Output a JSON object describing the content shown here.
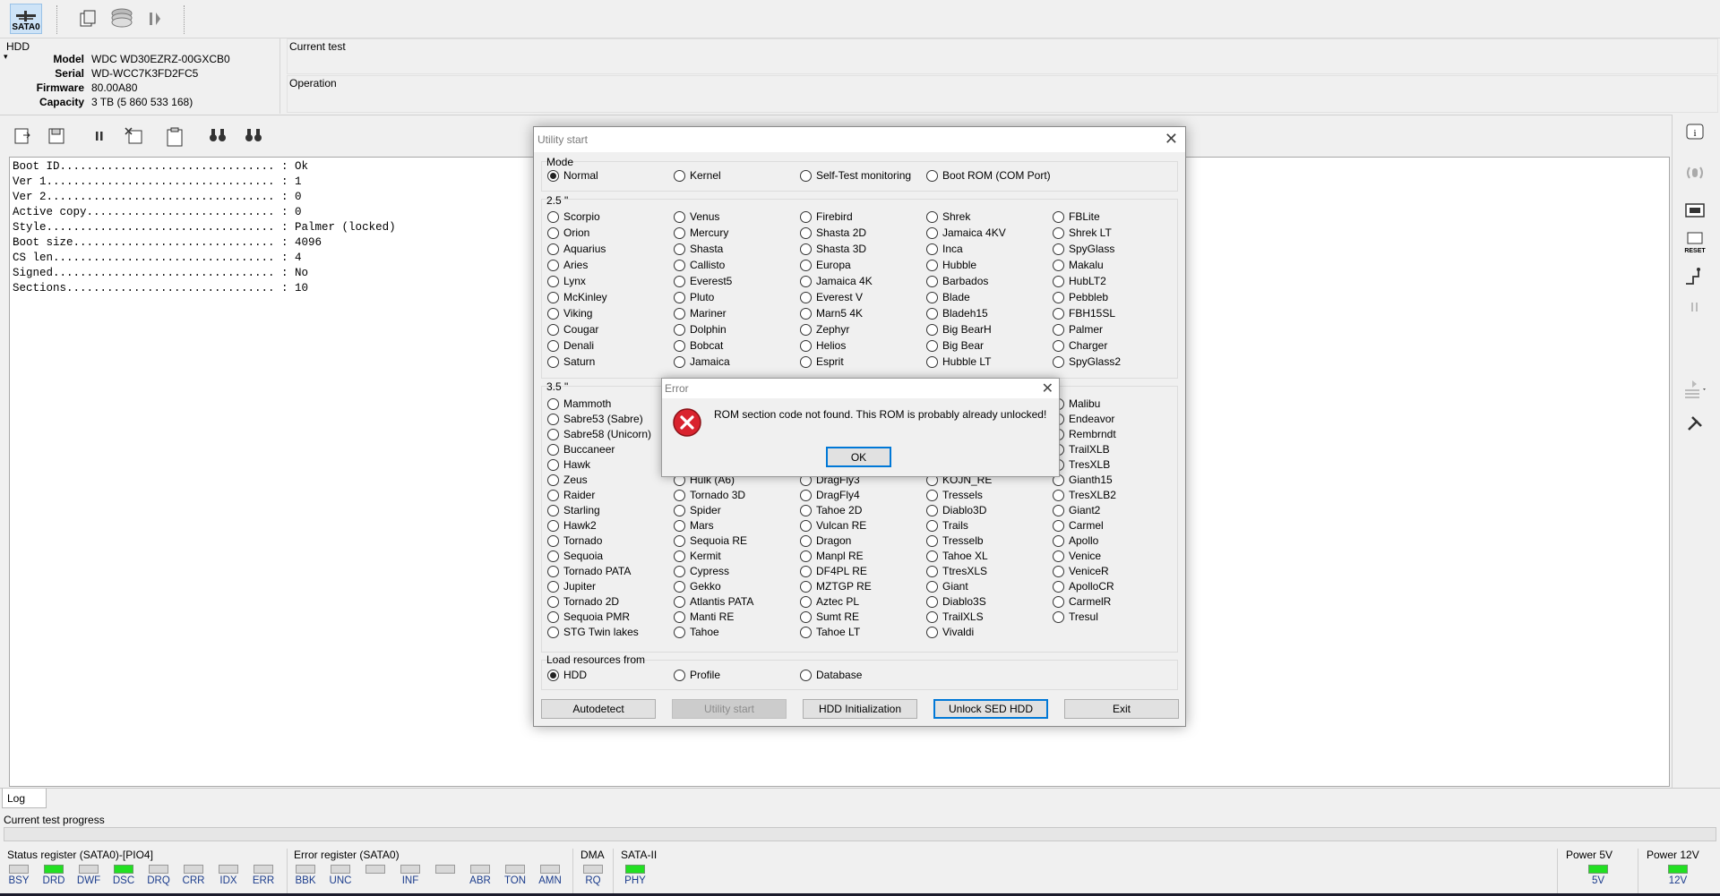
{
  "toolbar": {
    "port_label": "SATA0"
  },
  "hdd": {
    "group_label": "HDD",
    "fields": [
      {
        "label": "Model",
        "value": "WDC WD30EZRZ-00GXCB0"
      },
      {
        "label": "Serial",
        "value": "WD-WCC7K3FD2FC5"
      },
      {
        "label": "Firmware",
        "value": "80.00A80"
      },
      {
        "label": "Capacity",
        "value": "3 TB (5 860 533 168)"
      }
    ]
  },
  "current_test": {
    "label": "Current test",
    "value": ""
  },
  "operation": {
    "label": "Operation",
    "value": ""
  },
  "output_lines": [
    "Boot ID................................ : Ok",
    "Ver 1.................................. : 1",
    "Ver 2.................................. : 0",
    "Active copy............................ : 0",
    "Style.................................. : Palmer (locked)",
    "Boot size.............................. : 4096",
    "CS len................................. : 4",
    "Signed................................. : No",
    "Sections............................... : 10"
  ],
  "utility_dialog": {
    "title": "Utility start",
    "mode": {
      "label": "Mode",
      "options": [
        "Normal",
        "Kernel",
        "Self-Test monitoring",
        "Boot ROM (COM Port)"
      ],
      "selected": "Normal"
    },
    "family_25": {
      "label": "2.5 \"",
      "columns": [
        [
          "Scorpio",
          "Orion",
          "Aquarius",
          "Aries",
          "Lynx",
          "McKinley",
          "Viking",
          "Cougar",
          "Denali",
          "Saturn"
        ],
        [
          "Venus",
          "Mercury",
          "Shasta",
          "Callisto",
          "Everest5",
          "Pluto",
          "Mariner",
          "Dolphin",
          "Bobcat",
          "Jamaica"
        ],
        [
          "Firebird",
          "Shasta 2D",
          "Shasta 3D",
          "Europa",
          "Jamaica 4K",
          "Everest V",
          "Marn5 4K",
          "Zephyr",
          "Helios",
          "Esprit"
        ],
        [
          "Shrek",
          "Jamaica 4KV",
          "Inca",
          "Hubble",
          "Barbados",
          "Blade",
          "Bladeh15",
          "Big BearH",
          "Big Bear",
          "Hubble LT"
        ],
        [
          "FBLite",
          "Shrek LT",
          "SpyGlass",
          "Makalu",
          "HubLT2",
          "Pebbleb",
          "FBH15SL",
          "Palmer",
          "Charger",
          "SpyGlass2"
        ]
      ]
    },
    "family_35": {
      "label": "3.5 \"",
      "columns": [
        [
          "Mammoth",
          "Sabre53 (Sabre)",
          "Sabre58 (Unicorn)",
          "Buccaneer",
          "Hawk",
          "Zeus",
          "Raider",
          "Starling",
          "Hawk2",
          "Tornado",
          "Sequoia",
          "Tornado PATA",
          "Jupiter",
          "Tornado 2D",
          "Sequoia PMR",
          "STG Twin lakes"
        ],
        [
          "",
          "",
          "",
          "",
          "",
          "Hulk (A6)",
          "Tornado 3D",
          "Spider",
          "Mars",
          "Sequoia RE",
          "Kermit",
          "Cypress",
          "Gekko",
          "Atlantis PATA",
          "Manti RE",
          "Tahoe"
        ],
        [
          "",
          "",
          "",
          "",
          "",
          "DragFly3",
          "DragFly4",
          "Tahoe 2D",
          "Vulcan RE",
          "Dragon",
          "Manpl RE",
          "DF4PL RE",
          "MZTGP RE",
          "Aztec PL",
          "Sumt RE",
          "Tahoe LT"
        ],
        [
          "",
          "",
          "",
          "",
          "",
          "KOJN_RE",
          "Tressels",
          "Diablo3D",
          "Trails",
          "Tresselb",
          "Tahoe XL",
          "TtresXLS",
          "Giant",
          "Diablo3S",
          "TrailXLS",
          "Vivaldi"
        ],
        [
          "Malibu",
          "Endeavor",
          "Rembrndt",
          "TrailXLB",
          "TresXLB",
          "Gianth15",
          "TresXLB2",
          "Giant2",
          "Carmel",
          "Apollo",
          "Venice",
          "VeniceR",
          "ApolloCR",
          "CarmelR",
          "Tresul",
          ""
        ]
      ]
    },
    "load_resources": {
      "label": "Load resources from",
      "options": [
        "HDD",
        "Profile",
        "Database"
      ],
      "selected": "HDD"
    },
    "buttons": {
      "autodetect": "Autodetect",
      "utility_start": "Utility start",
      "hdd_init": "HDD Initialization",
      "unlock_sed": "Unlock SED HDD",
      "exit": "Exit"
    }
  },
  "error_dialog": {
    "title": "Error",
    "message": "ROM section code not found. This ROM is probably already unlocked!",
    "ok": "OK"
  },
  "log": {
    "tab": "Log",
    "progress_label": "Current test progress"
  },
  "status": {
    "status_register_label": "Status register (SATA0)-[PIO4]",
    "status_leds": [
      {
        "name": "BSY",
        "on": false
      },
      {
        "name": "DRD",
        "on": true
      },
      {
        "name": "DWF",
        "on": false
      },
      {
        "name": "DSC",
        "on": true
      },
      {
        "name": "DRQ",
        "on": false
      },
      {
        "name": "CRR",
        "on": false
      },
      {
        "name": "IDX",
        "on": false
      },
      {
        "name": "ERR",
        "on": false
      }
    ],
    "error_register_label": "Error register (SATA0)",
    "error_leds": [
      {
        "name": "BBK",
        "on": false
      },
      {
        "name": "UNC",
        "on": false
      },
      {
        "name": "",
        "on": false
      },
      {
        "name": "INF",
        "on": false
      },
      {
        "name": "",
        "on": false
      },
      {
        "name": "ABR",
        "on": false
      },
      {
        "name": "TON",
        "on": false
      },
      {
        "name": "AMN",
        "on": false
      }
    ],
    "dma_label": "DMA",
    "dma_led": {
      "name": "RQ",
      "on": false
    },
    "sata_label": "SATA-II",
    "sata_led": {
      "name": "PHY",
      "on": true
    },
    "power5_label": "Power 5V",
    "power5_led": {
      "name": "5V",
      "on": true
    },
    "power12_label": "Power 12V",
    "power12_led": {
      "name": "12V",
      "on": true
    }
  },
  "colors": {
    "led_on": "#22e022",
    "accent": "#0078d7",
    "error_red": "#d9232e"
  }
}
